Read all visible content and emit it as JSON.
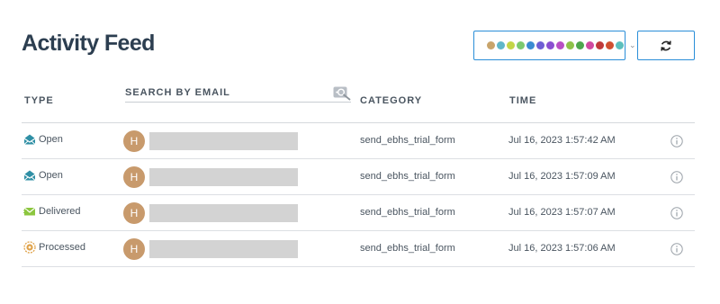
{
  "title": "Activity Feed",
  "filter": {
    "colors": [
      "#c8a46b",
      "#5fb7c9",
      "#c3d547",
      "#7bc96f",
      "#3a8bd2",
      "#6f5ed4",
      "#8a4fd0",
      "#b94fc4",
      "#8ec24a",
      "#4da64d",
      "#d04aa0",
      "#c03a3a",
      "#d05030",
      "#5bbfbd"
    ]
  },
  "columns": {
    "type": "TYPE",
    "email": "SEARCH BY EMAIL",
    "category": "CATEGORY",
    "time": "TIME"
  },
  "rows": [
    {
      "type": "Open",
      "type_icon": "open-envelope-icon",
      "avatar": "H",
      "category": "send_ebhs_trial_form",
      "time": "Jul 16, 2023 1:57:42 AM"
    },
    {
      "type": "Open",
      "type_icon": "open-envelope-icon",
      "avatar": "H",
      "category": "send_ebhs_trial_form",
      "time": "Jul 16, 2023 1:57:09 AM"
    },
    {
      "type": "Delivered",
      "type_icon": "delivered-envelope-icon",
      "avatar": "H",
      "category": "send_ebhs_trial_form",
      "time": "Jul 16, 2023 1:57:07 AM"
    },
    {
      "type": "Processed",
      "type_icon": "processed-gear-icon",
      "avatar": "H",
      "category": "send_ebhs_trial_form",
      "time": "Jul 16, 2023 1:57:06 AM"
    }
  ]
}
